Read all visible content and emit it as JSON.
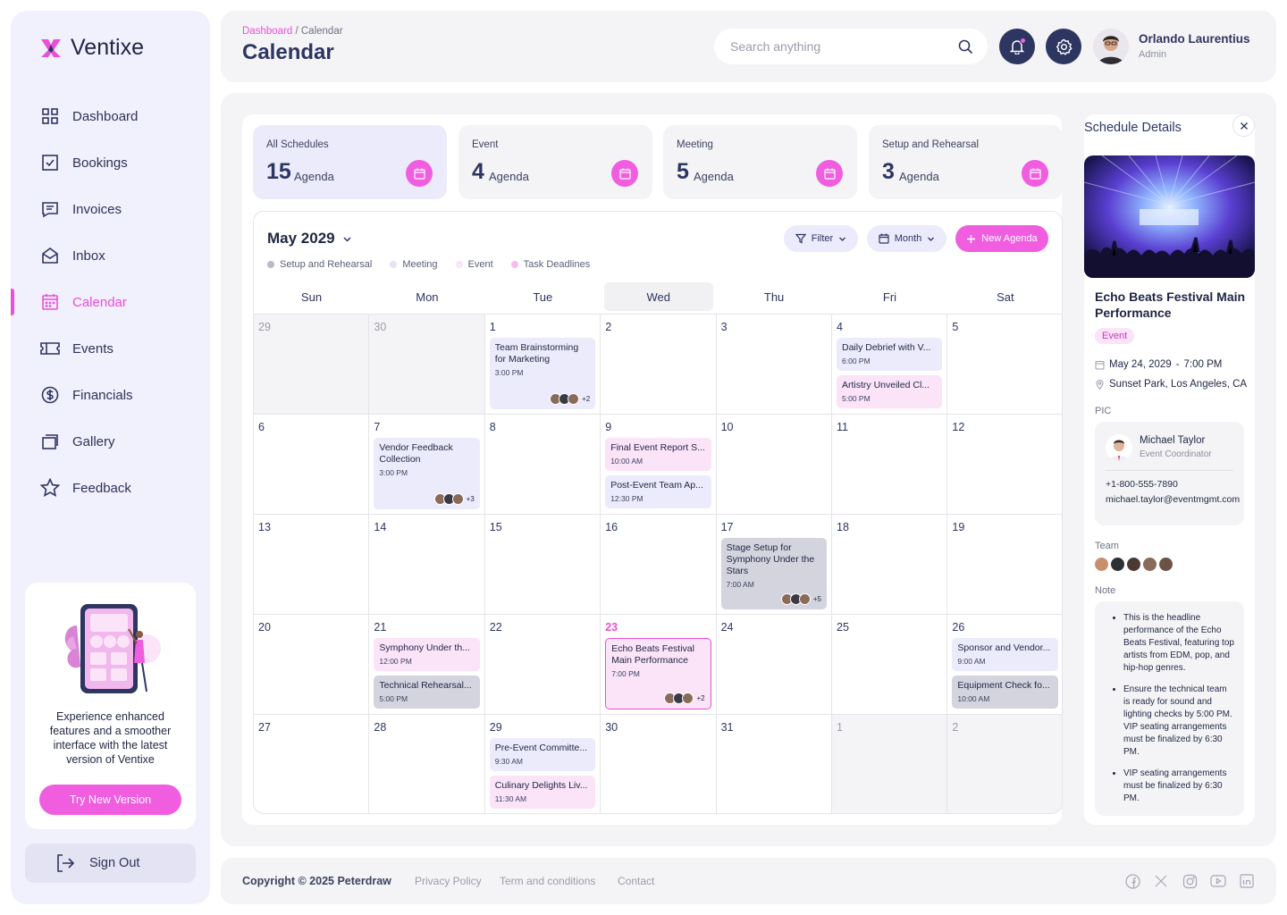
{
  "app": {
    "name": "Ventixe"
  },
  "colors": {
    "accent": "#e94fd9",
    "navy": "#2d3561",
    "lavender": "#ecebfb",
    "pinkLight": "#fbe3f8",
    "grayEvent": "#d3d4de"
  },
  "sidebar": {
    "items": [
      {
        "label": "Dashboard",
        "icon": "dashboard-icon"
      },
      {
        "label": "Bookings",
        "icon": "bookings-icon"
      },
      {
        "label": "Invoices",
        "icon": "invoices-icon"
      },
      {
        "label": "Inbox",
        "icon": "inbox-icon"
      },
      {
        "label": "Calendar",
        "icon": "calendar-icon",
        "active": true
      },
      {
        "label": "Events",
        "icon": "ticket-icon"
      },
      {
        "label": "Financials",
        "icon": "dollar-icon"
      },
      {
        "label": "Gallery",
        "icon": "gallery-icon"
      },
      {
        "label": "Feedback",
        "icon": "star-icon"
      }
    ],
    "promo": {
      "text": "Experience enhanced features and a smoother interface with the latest version of Ventixe",
      "button": "Try New Version"
    },
    "signout": "Sign Out"
  },
  "header": {
    "breadcrumb": {
      "parent": "Dashboard",
      "separator": "/",
      "current": "Calendar"
    },
    "title": "Calendar",
    "search_placeholder": "Search anything",
    "user": {
      "name": "Orlando Laurentius",
      "role": "Admin"
    }
  },
  "stats": [
    {
      "label": "All Schedules",
      "count": "15",
      "unit": "Agenda"
    },
    {
      "label": "Event",
      "count": "4",
      "unit": "Agenda"
    },
    {
      "label": "Meeting",
      "count": "5",
      "unit": "Agenda"
    },
    {
      "label": "Setup and Rehearsal",
      "count": "3",
      "unit": "Agenda"
    }
  ],
  "calendar": {
    "month": "May 2029",
    "filter": "Filter",
    "view": "Month",
    "new": "New Agenda",
    "legend": [
      {
        "label": "Setup and Rehearsal",
        "color": "#b9bac8"
      },
      {
        "label": "Meeting",
        "color": "#ecebfb"
      },
      {
        "label": "Event",
        "color": "#fbe3f8"
      },
      {
        "label": "Task Deadlines",
        "color": "#f5bdef"
      }
    ],
    "weekdays": [
      "Sun",
      "Mon",
      "Tue",
      "Wed",
      "Thu",
      "Fri",
      "Sat"
    ],
    "weeks": [
      [
        {
          "d": "29",
          "muted": true
        },
        {
          "d": "30",
          "muted": true
        },
        {
          "d": "1",
          "events": [
            {
              "title": "Team Brainstorming for Marketing",
              "time": "3:00 PM",
              "color": "blue",
              "wrap": true,
              "avatars": 3,
              "more": "+2"
            }
          ]
        },
        {
          "d": "2"
        },
        {
          "d": "3"
        },
        {
          "d": "4",
          "events": [
            {
              "title": "Daily Debrief with V...",
              "time": "6:00 PM",
              "color": "blue"
            },
            {
              "title": "Artistry Unveiled Cl...",
              "time": "5:00 PM",
              "color": "pink"
            }
          ]
        },
        {
          "d": "5"
        }
      ],
      [
        {
          "d": "6"
        },
        {
          "d": "7",
          "events": [
            {
              "title": "Vendor Feedback Collection",
              "time": "3:00 PM",
              "color": "blue",
              "wrap": true,
              "avatars": 3,
              "more": "+3"
            }
          ]
        },
        {
          "d": "8"
        },
        {
          "d": "9",
          "events": [
            {
              "title": "Final Event Report S...",
              "time": "10:00 AM",
              "color": "pink"
            },
            {
              "title": "Post-Event Team Ap...",
              "time": "12:30 PM",
              "color": "blue"
            }
          ]
        },
        {
          "d": "10"
        },
        {
          "d": "11"
        },
        {
          "d": "12"
        }
      ],
      [
        {
          "d": "13"
        },
        {
          "d": "14"
        },
        {
          "d": "15"
        },
        {
          "d": "16"
        },
        {
          "d": "17",
          "events": [
            {
              "title": "Stage Setup for Symphony Under the Stars",
              "time": "7:00 AM",
              "color": "gray",
              "wrap": true,
              "avatars": 3,
              "more": "+5"
            }
          ]
        },
        {
          "d": "18"
        },
        {
          "d": "19"
        }
      ],
      [
        {
          "d": "20"
        },
        {
          "d": "21",
          "events": [
            {
              "title": "Symphony Under th...",
              "time": "12:00 PM",
              "color": "pink"
            },
            {
              "title": "Technical Rehearsal...",
              "time": "5:00 PM",
              "color": "gray"
            }
          ]
        },
        {
          "d": "22"
        },
        {
          "d": "23",
          "today": true,
          "events": [
            {
              "title": "Echo Beats Festival Main Performance",
              "time": "7:00 PM",
              "color": "sel",
              "wrap": true,
              "avatars": 3,
              "more": "+2"
            }
          ]
        },
        {
          "d": "24"
        },
        {
          "d": "25"
        },
        {
          "d": "26",
          "events": [
            {
              "title": "Sponsor and Vendor...",
              "time": "9:00 AM",
              "color": "blue"
            },
            {
              "title": "Equipment Check fo...",
              "time": "10:00 AM",
              "color": "gray"
            }
          ]
        }
      ],
      [
        {
          "d": "27"
        },
        {
          "d": "28"
        },
        {
          "d": "29",
          "events": [
            {
              "title": "Pre-Event Committe...",
              "time": "9:30 AM",
              "color": "blue"
            },
            {
              "title": "Culinary Delights Liv...",
              "time": "11:30 AM",
              "color": "pink"
            }
          ]
        },
        {
          "d": "30"
        },
        {
          "d": "31"
        },
        {
          "d": "1",
          "muted": true
        },
        {
          "d": "2",
          "muted": true
        }
      ]
    ]
  },
  "details": {
    "title": "Schedule Details",
    "event_name": "Echo Beats Festival Main Performance",
    "category": "Event",
    "date": "May 24, 2029",
    "date_sep": "-",
    "time": "7:00 PM",
    "location": "Sunset Park, Los Angeles, CA",
    "pic_label": "PIC",
    "pic": {
      "name": "Michael Taylor",
      "role": "Event Coordinator",
      "phone": "+1-800-555-7890",
      "email": "michael.taylor@eventmgmt.com"
    },
    "team_label": "Team",
    "note_label": "Note",
    "notes": [
      "This is the headline performance of the Echo Beats Festival, featuring top artists from EDM, pop, and hip-hop genres.",
      "Ensure the technical team is ready for sound and lighting checks by 5:00 PM. VIP seating arrangements must be finalized by 6:30 PM.",
      "VIP seating arrangements must be finalized by 6:30 PM."
    ]
  },
  "footer": {
    "copyright": "Copyright © 2025 Peterdraw",
    "links": [
      "Privacy Policy",
      "Term and conditions",
      "Contact"
    ],
    "social": [
      "facebook-icon",
      "x-icon",
      "instagram-icon",
      "youtube-icon",
      "linkedin-icon"
    ]
  }
}
